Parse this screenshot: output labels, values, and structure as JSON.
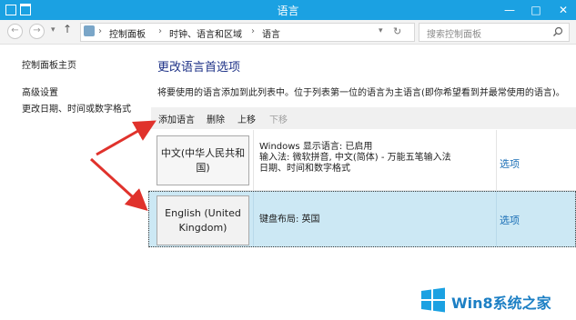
{
  "window": {
    "title": "语言",
    "controls": [
      "—",
      "□",
      "✕"
    ]
  },
  "address_bar": {
    "back": "←",
    "forward": "→",
    "up": "↑",
    "breadcrumb": [
      "控制面板",
      "时钟、语言和区域",
      "语言"
    ],
    "separator": "›",
    "search_placeholder": "搜索控制面板"
  },
  "sidebar": {
    "items": [
      {
        "label": "控制面板主页"
      },
      {
        "label": "高级设置"
      },
      {
        "label": "更改日期、时间或数字格式"
      }
    ]
  },
  "main": {
    "heading": "更改语言首选项",
    "description": "将要使用的语言添加到此列表中。位于列表第一位的语言为主语言(即你希望看到并最常使用的语言)。",
    "toolbar": {
      "add": "添加语言",
      "remove": "删除",
      "up": "上移",
      "down": "下移"
    },
    "languages": [
      {
        "name": "中文(中华人民共和国)",
        "details": [
          "Windows 显示语言: 已启用",
          "输入法: 微软拼音, 中文(简体) - 万能五笔输入法",
          "日期、时间和数字格式"
        ],
        "options": "选项",
        "selected": false
      },
      {
        "name": "English (United Kingdom)",
        "details": [
          "键盘布局: 英国"
        ],
        "options": "选项",
        "selected": true
      }
    ]
  },
  "watermark": {
    "text": "Win8系统之家"
  },
  "colors": {
    "titlebar": "#1ba1e2",
    "heading": "#1e3287",
    "link": "#1b6fb6",
    "selected_row": "#cce8f4",
    "arrow": "#e0322c"
  }
}
